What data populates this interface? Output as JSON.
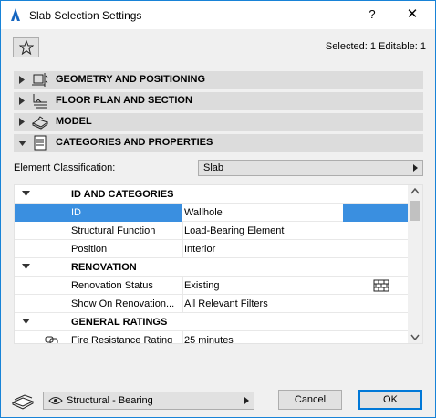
{
  "window": {
    "title": "Slab Selection Settings",
    "help_label": "?",
    "close_label": "✕"
  },
  "toolbar": {
    "selected_info": "Selected: 1 Editable: 1"
  },
  "panels": [
    {
      "label": "GEOMETRY AND POSITIONING",
      "icon": "geometry-icon",
      "expanded": false
    },
    {
      "label": "FLOOR PLAN AND SECTION",
      "icon": "floor-plan-icon",
      "expanded": false
    },
    {
      "label": "MODEL",
      "icon": "model-icon",
      "expanded": false
    },
    {
      "label": "CATEGORIES AND PROPERTIES",
      "icon": "properties-icon",
      "expanded": true
    }
  ],
  "element_classification": {
    "label": "Element Classification:",
    "value": "Slab"
  },
  "grid": {
    "rows": [
      {
        "type": "group",
        "name": "ID AND CATEGORIES"
      },
      {
        "type": "item",
        "name": "ID",
        "value": "Wallhole",
        "selected": true
      },
      {
        "type": "item",
        "name": "Structural Function",
        "value": "Load-Bearing Element"
      },
      {
        "type": "item",
        "name": "Position",
        "value": "Interior"
      },
      {
        "type": "group",
        "name": "RENOVATION"
      },
      {
        "type": "item",
        "name": "Renovation Status",
        "value": "Existing",
        "icon": "renovation-status-icon"
      },
      {
        "type": "item",
        "name": "Show On Renovation...",
        "value": "All Relevant Filters"
      },
      {
        "type": "group",
        "name": "GENERAL RATINGS"
      },
      {
        "type": "item",
        "name": "Fire Resistance Rating",
        "value": "25 minutes",
        "icon": "link-icon"
      }
    ]
  },
  "footer": {
    "view_value": "Structural - Bearing",
    "cancel_label": "Cancel",
    "ok_label": "OK"
  },
  "colors": {
    "accent": "#1883d7",
    "selection": "#3a8fe0",
    "panel_header": "#dcdcdc"
  }
}
